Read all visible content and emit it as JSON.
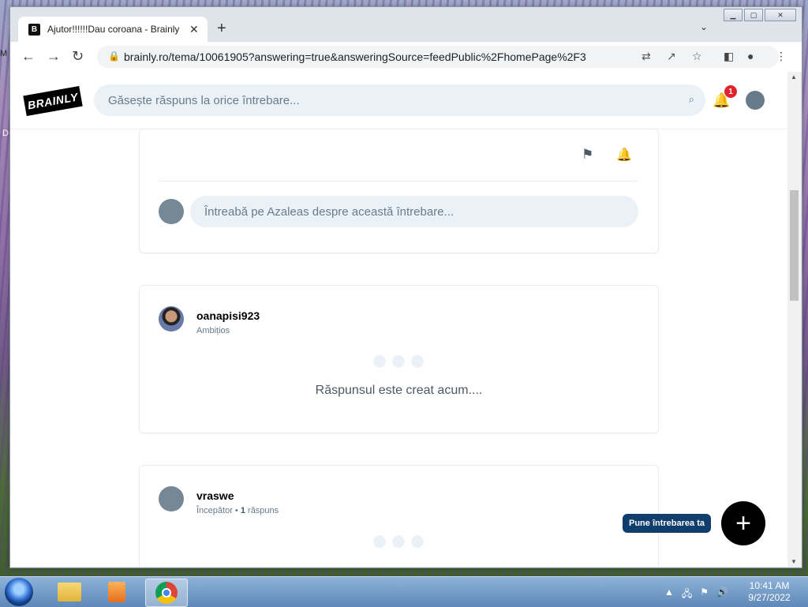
{
  "desktop": {
    "label_top": "M",
    "label_mid": "D"
  },
  "browser": {
    "tab_title": "Ajutor!!!!!!Dau coroana - Brainly",
    "tab_favicon": "B",
    "url": "brainly.ro/tema/10061905?answering=true&answeringSource=feedPublic%2FhomePage%2F3"
  },
  "site": {
    "logo": "BRAINLY",
    "search_placeholder": "Găsește răspuns la orice întrebare...",
    "notification_count": "1"
  },
  "question_card": {
    "comment_placeholder": "Întreabă pe Azaleas despre această întrebare..."
  },
  "answers": [
    {
      "name": "oanapisi923",
      "rank": "Ambițios",
      "status": "Răspunsul este creat acum...."
    },
    {
      "name": "vraswe",
      "rank": "Începător",
      "answers_count": "1",
      "answers_label": "răspuns"
    }
  ],
  "fab": {
    "label": "Pune întrebarea ta",
    "icon": "+"
  },
  "taskbar": {
    "time": "10:41 AM",
    "date": "9/27/2022"
  }
}
